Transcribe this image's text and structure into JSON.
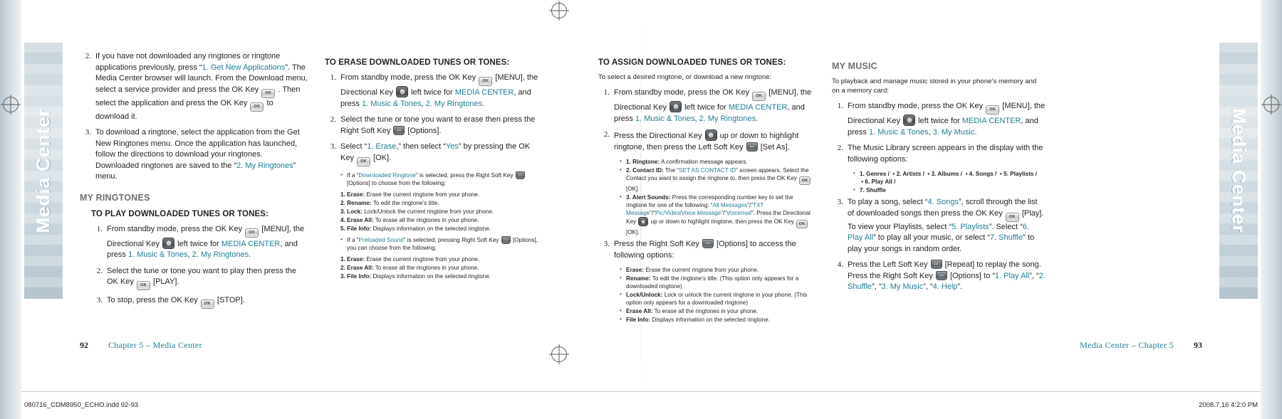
{
  "document": {
    "left_tab_label": "Media Center",
    "right_tab_label": "Media Center"
  },
  "col1": {
    "steps": [
      {
        "num": "2.",
        "parts": [
          {
            "t": "If you have not downloaded any ringtones or ringtone applications previously, press “",
            "s": "plain"
          },
          {
            "t": "1. Get New Applications",
            "s": "link"
          },
          {
            "t": "”. The Media Center browser will launch. From the Download menu, select a service provider and press the OK Key ",
            "s": "plain"
          },
          {
            "t": "[OK-KEY]",
            "s": "glyph"
          },
          {
            "t": " . Then select the application and press the OK Key ",
            "s": "plain"
          },
          {
            "t": "[OK-KEY]",
            "s": "glyph"
          },
          {
            "t": " to download it.",
            "s": "plain"
          }
        ]
      },
      {
        "num": "3.",
        "parts": [
          {
            "t": "To download a ringtone, select the application from the Get New Ringtones menu. Once the application has launched, follow the directions to download your ringtones. Downloaded ringtones are saved to the “",
            "s": "plain"
          },
          {
            "t": "2. My Ringtones",
            "s": "link"
          },
          {
            "t": "” menu.",
            "s": "plain"
          }
        ]
      }
    ],
    "heading": "MY RINGTONES",
    "subheading": "TO PLAY DOWNLOADED TUNES OR TONES:",
    "steps2": [
      {
        "num": "1.",
        "parts": [
          {
            "t": "From standby mode, press the OK Key ",
            "s": "plain"
          },
          {
            "t": "[OK-KEY]",
            "s": "glyph"
          },
          {
            "t": " [MENU], the Directional Key ",
            "s": "plain"
          },
          {
            "t": "[NAV-KEY]",
            "s": "glyph"
          },
          {
            "t": " left twice for ",
            "s": "plain"
          },
          {
            "t": "MEDIA CENTER",
            "s": "link"
          },
          {
            "t": ", and press ",
            "s": "plain"
          },
          {
            "t": "1. Music & Tones",
            "s": "link"
          },
          {
            "t": ", ",
            "s": "plain"
          },
          {
            "t": "2. My Ringtones",
            "s": "link"
          },
          {
            "t": ".",
            "s": "plain"
          }
        ]
      },
      {
        "num": "2.",
        "parts": [
          {
            "t": "Select the tune or tone you want to play then press the OK Key ",
            "s": "plain"
          },
          {
            "t": "[OK-KEY]",
            "s": "glyph"
          },
          {
            "t": " [PLAY].",
            "s": "plain"
          }
        ]
      },
      {
        "num": "3.",
        "parts": [
          {
            "t": "To stop, press the OK Key ",
            "s": "plain"
          },
          {
            "t": "[OK-KEY]",
            "s": "glyph"
          },
          {
            "t": " [STOP].",
            "s": "plain"
          }
        ]
      }
    ]
  },
  "col2": {
    "heading": "TO ERASE DOWNLOADED TUNES OR TONES:",
    "steps": [
      {
        "num": "1.",
        "parts": [
          {
            "t": "From standby mode, press the OK Key ",
            "s": "plain"
          },
          {
            "t": "[OK-KEY]",
            "s": "glyph"
          },
          {
            "t": " [MENU], the Directional Key ",
            "s": "plain"
          },
          {
            "t": "[NAV-KEY]",
            "s": "glyph"
          },
          {
            "t": " left twice for ",
            "s": "plain"
          },
          {
            "t": "MEDIA CENTER",
            "s": "link"
          },
          {
            "t": ", and press ",
            "s": "plain"
          },
          {
            "t": "1. Music & Tones",
            "s": "link"
          },
          {
            "t": ", ",
            "s": "plain"
          },
          {
            "t": "2. My Ringtones",
            "s": "link"
          },
          {
            "t": ".",
            "s": "plain"
          }
        ]
      },
      {
        "num": "2.",
        "parts": [
          {
            "t": "Select the tune or tone you want to erase then press the Right Soft Key ",
            "s": "plain"
          },
          {
            "t": "[SOFT-KEY]",
            "s": "glyph"
          },
          {
            "t": " [Options].",
            "s": "plain"
          }
        ]
      },
      {
        "num": "3.",
        "parts": [
          {
            "t": "Select “",
            "s": "plain"
          },
          {
            "t": "1. Erase",
            "s": "link"
          },
          {
            "t": ",” then select “",
            "s": "plain"
          },
          {
            "t": "Yes",
            "s": "link"
          },
          {
            "t": "” by pressing the OK Key ",
            "s": "plain"
          },
          {
            "t": "[OK-KEY]",
            "s": "glyph"
          },
          {
            "t": " [OK].",
            "s": "plain"
          }
        ]
      }
    ],
    "note1_lead_a": "If a “",
    "note1_lead_link": "Downloaded Ringtone",
    "note1_lead_b": "” is selected, press the Right Soft Key ",
    "note1_lead_c": " [Options] to choose from the following:",
    "note1_items": [
      {
        "label": "1. Erase:",
        "text": " Erase the current ringtone from your phone."
      },
      {
        "label": "2. Rename:",
        "text": " To edit the ringtone’s title."
      },
      {
        "label": "3. Lock:",
        "text": " Lock/Unlock the current ringtone from your phone."
      },
      {
        "label": "4. Erase All:",
        "text": " To erase all the ringtones in your phone."
      },
      {
        "label": "5. File Info:",
        "text": " Displays information on the selected ringtone."
      }
    ],
    "note2_lead_a": "If a “",
    "note2_lead_link": "Preloaded Sound",
    "note2_lead_b": "” is selected, pressing Right Soft Key ",
    "note2_lead_c": " [Options], you can choose from the following:",
    "note2_items": [
      {
        "label": "1. Erase:",
        "text": " Erase the current ringtone from your phone."
      },
      {
        "label": "2. Erase All:",
        "text": " To erase all the ringtones in your phone."
      },
      {
        "label": "3. File Info:",
        "text": " Displays information on the selected ringtone."
      }
    ]
  },
  "col3": {
    "heading": "TO ASSIGN DOWNLOADED TUNES OR TONES:",
    "lead": "To select a desired ringtone, or download a new ringtone:",
    "steps": [
      {
        "num": "1.",
        "parts": [
          {
            "t": "From standby mode, press the OK Key ",
            "s": "plain"
          },
          {
            "t": "[OK-KEY]",
            "s": "glyph"
          },
          {
            "t": " [MENU], the Directional Key ",
            "s": "plain"
          },
          {
            "t": "[NAV-KEY]",
            "s": "glyph"
          },
          {
            "t": " left twice for ",
            "s": "plain"
          },
          {
            "t": "MEDIA CENTER",
            "s": "link"
          },
          {
            "t": ", and press ",
            "s": "plain"
          },
          {
            "t": "1. Music & Tones",
            "s": "link"
          },
          {
            "t": ", ",
            "s": "plain"
          },
          {
            "t": "2. My Ringtones",
            "s": "link"
          },
          {
            "t": ".",
            "s": "plain"
          }
        ]
      },
      {
        "num": "2.",
        "parts": [
          {
            "t": "Press the Directional Key ",
            "s": "plain"
          },
          {
            "t": "[NAV-KEY]",
            "s": "glyph"
          },
          {
            "t": " up or down to highlight ringtone, then press the Left Soft Key ",
            "s": "plain"
          },
          {
            "t": "[SOFT-KEY]",
            "s": "glyph"
          },
          {
            "t": " [Set As].",
            "s": "plain"
          }
        ]
      }
    ],
    "bullets": [
      {
        "label": "1. Ringtone:",
        "text": " A confirmation message appears."
      },
      {
        "label": "2. Contact ID:",
        "text_pre": " The “",
        "link": "SET AS CONTACT ID",
        "text_post": "” screen appears. Select the Contact you want to assign the ringtone to, then press the OK Key ",
        "glyph": "[OK-KEY]",
        "text_end": " [OK]."
      },
      {
        "label": "3. Alert Sounds:",
        "text_pre": " Press the corresponding number key to set the ringtone for one of the following: “",
        "links": [
          "All Messages",
          "TXT Message",
          "Pic/Video/Voice Message",
          "Voicemail"
        ],
        "text_post": "”. Press the Directional Key ",
        "glyph": "[NAV-KEY]",
        "text_end": " up or down to highlight ringtone, then press the OK Key ",
        "glyph2": "[OK-KEY]",
        "text_end2": " [OK]."
      }
    ],
    "step3": {
      "num": "3.",
      "parts": [
        {
          "t": "Press the Right Soft Key ",
          "s": "plain"
        },
        {
          "t": "[SOFT-KEY]",
          "s": "glyph"
        },
        {
          "t": " [Options] to access the following options:",
          "s": "plain"
        }
      ]
    },
    "step3_items": [
      {
        "label": "Erase:",
        "text": " Erase the current ringtone from your phone."
      },
      {
        "label": "Rename:",
        "text": " To edit the ringtone’s title. (This option only appears for a downloaded ringtone)"
      },
      {
        "label": "Lock/Unlock:",
        "text": " Lock or unlock the current ringtone in your phone. (This option only appears for a downloaded ringtone)"
      },
      {
        "label": "Erase All:",
        "text": " To erase all the ringtones in your phone."
      },
      {
        "label": "File Info:",
        "text": " Displays information on the selected ringtone."
      }
    ]
  },
  "col4": {
    "heading": "MY MUSIC",
    "lead": "To playback and manage music stored in your phone’s memory and on a memory card:",
    "steps": [
      {
        "num": "1.",
        "parts": [
          {
            "t": "From standby mode, press the OK Key ",
            "s": "plain"
          },
          {
            "t": "[OK-KEY]",
            "s": "glyph"
          },
          {
            "t": " [MENU], the Directional Key ",
            "s": "plain"
          },
          {
            "t": "[NAV-KEY]",
            "s": "glyph"
          },
          {
            "t": " left twice for ",
            "s": "plain"
          },
          {
            "t": "MEDIA CENTER",
            "s": "link"
          },
          {
            "t": ", and press ",
            "s": "plain"
          },
          {
            "t": "1. Music & Tones",
            "s": "link"
          },
          {
            "t": ", ",
            "s": "plain"
          },
          {
            "t": "3. My Music",
            "s": "link"
          },
          {
            "t": ".",
            "s": "plain"
          }
        ]
      },
      {
        "num": "2.",
        "parts": [
          {
            "t": "The Music Library screen appears in the display with the following options:",
            "s": "plain"
          }
        ]
      }
    ],
    "options_line1": "1. Genres /",
    "options_line2": "2. Artists /",
    "options_line3": "3. Albums /",
    "options_line4": "4. Songs /",
    "options_line5": "5. Playlists /",
    "options_line6": "6. Play All /",
    "options_line7": "7. Shuffle",
    "step3": {
      "num": "3.",
      "parts": [
        {
          "t": "To play a song, select “",
          "s": "plain"
        },
        {
          "t": "4. Songs",
          "s": "link"
        },
        {
          "t": "”, scroll through the list of downloaded songs then press the OK Key ",
          "s": "plain"
        },
        {
          "t": "[OK-KEY]",
          "s": "glyph"
        },
        {
          "t": " [Play]. To view your Playlists, select “",
          "s": "plain"
        },
        {
          "t": "5. Playlists",
          "s": "link"
        },
        {
          "t": "”. Select “",
          "s": "plain"
        },
        {
          "t": "6. Play All",
          "s": "link"
        },
        {
          "t": "” to play all your music, or select “",
          "s": "plain"
        },
        {
          "t": "7. Shuffle",
          "s": "link"
        },
        {
          "t": "” to play your songs in random order.",
          "s": "plain"
        }
      ]
    },
    "step4": {
      "num": "4.",
      "parts": [
        {
          "t": "Press the Left Soft Key ",
          "s": "plain"
        },
        {
          "t": "[SOFT-KEY]",
          "s": "glyph"
        },
        {
          "t": " [Repeat] to replay the song. Press the Right Soft Key ",
          "s": "plain"
        },
        {
          "t": "[SOFT-KEY]",
          "s": "glyph"
        },
        {
          "t": " [Options] to “",
          "s": "plain"
        },
        {
          "t": "1. Play All",
          "s": "link"
        },
        {
          "t": "”, “",
          "s": "plain"
        },
        {
          "t": "2. Shuffle",
          "s": "link"
        },
        {
          "t": "”, “",
          "s": "plain"
        },
        {
          "t": "3. My Music",
          "s": "link"
        },
        {
          "t": "”, “",
          "s": "plain"
        },
        {
          "t": "4. Help",
          "s": "link"
        },
        {
          "t": "”.",
          "s": "plain"
        }
      ]
    }
  },
  "footer": {
    "left_page_number": "92",
    "left_page_title": "Chapter 5 – Media Center",
    "right_page_title": "Media Center – Chapter 5",
    "right_page_number": "93",
    "slug_left": "080716_CDM8950_ECHO.indd   92-93",
    "slug_right": "2008.7.16   4:2:0 PM"
  },
  "colors": {
    "link": "#1f7d94",
    "body": "#231f20",
    "heading_grey": "#6d6e71",
    "tab_bg": "#c5d2da"
  }
}
